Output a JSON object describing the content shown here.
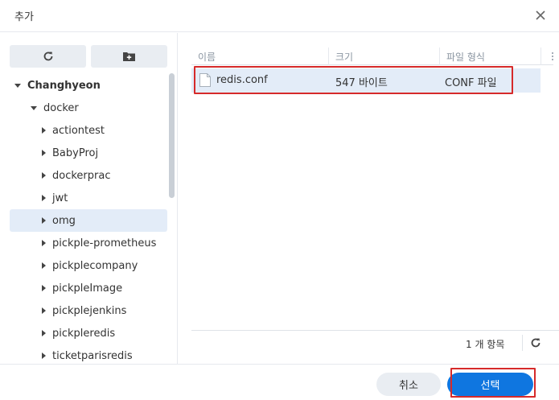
{
  "dialog": {
    "title": "추가"
  },
  "tree": {
    "root": "Changhyeon",
    "folder": "docker",
    "items": [
      "actiontest",
      "BabyProj",
      "dockerprac",
      "jwt",
      "omg",
      "pickple-prometheus",
      "pickplecompany",
      "pickpleImage",
      "pickplejenkins",
      "pickpleredis",
      "ticketparisredis"
    ],
    "selected": "omg"
  },
  "table": {
    "columns": [
      "이름",
      "크기",
      "파일 형식"
    ],
    "rows": [
      {
        "name": "redis.conf",
        "size": "547 바이트",
        "type": "CONF 파일"
      }
    ]
  },
  "footer": {
    "count": "1 개 항목"
  },
  "buttons": {
    "cancel": "취소",
    "select": "선택"
  },
  "colors": {
    "accent": "#0f76e0",
    "highlight": "#d62a2a",
    "selection": "#e3ecf8"
  },
  "icons": [
    "close-icon",
    "refresh-icon",
    "new-folder-icon",
    "file-icon",
    "kebab-menu-icon",
    "triangle-expand-icon",
    "triangle-collapse-icon"
  ]
}
